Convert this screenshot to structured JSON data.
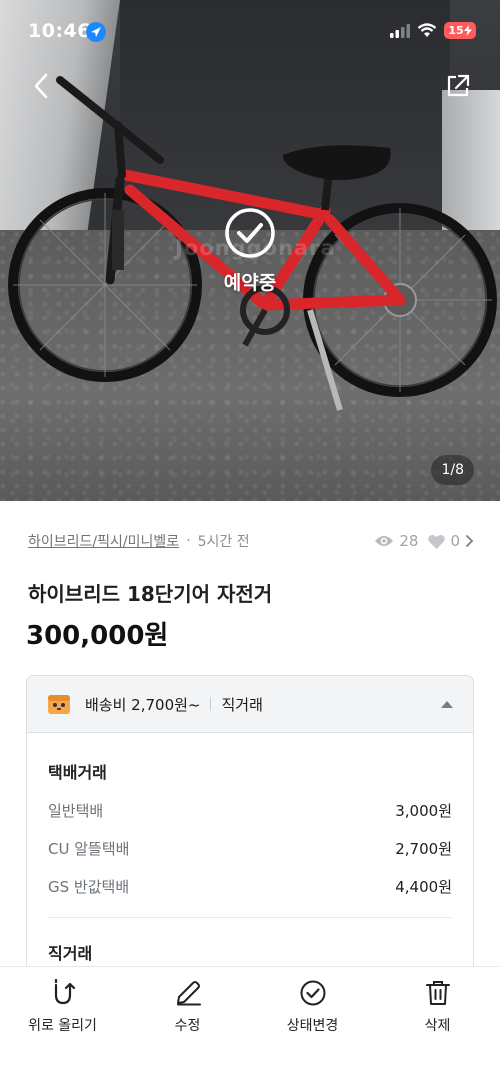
{
  "status_bar": {
    "time": "10:46",
    "battery": "15"
  },
  "gallery": {
    "status_overlay": "예약중",
    "watermark": "Joonggonara",
    "page_counter": "1/8"
  },
  "product": {
    "category": "하이브리드/픽시/미니벨로",
    "posted_ago": "5시간 전",
    "views": "28",
    "likes": "0",
    "title": "하이브리드 18단기어 자전거",
    "price": "300,000원"
  },
  "shipping": {
    "summary": "배송비 2,700원~",
    "direct_label": "직거래",
    "delivery_section_title": "택배거래",
    "options": [
      {
        "name": "일반택배",
        "fee": "3,000원"
      },
      {
        "name": "CU 알뜰택배",
        "fee": "2,700원"
      },
      {
        "name": "GS 반값택배",
        "fee": "4,400원"
      }
    ],
    "direct_section_title": "직거래"
  },
  "actions": [
    {
      "label": "위로 올리기",
      "icon": "bump-up-icon"
    },
    {
      "label": "수정",
      "icon": "pencil-icon"
    },
    {
      "label": "상태변경",
      "icon": "check-circle-icon"
    },
    {
      "label": "삭제",
      "icon": "trash-icon"
    }
  ],
  "colors": {
    "location_blue": "#1e88ff",
    "battery_red": "#ff5b5b",
    "bike_red": "#d8262b"
  }
}
